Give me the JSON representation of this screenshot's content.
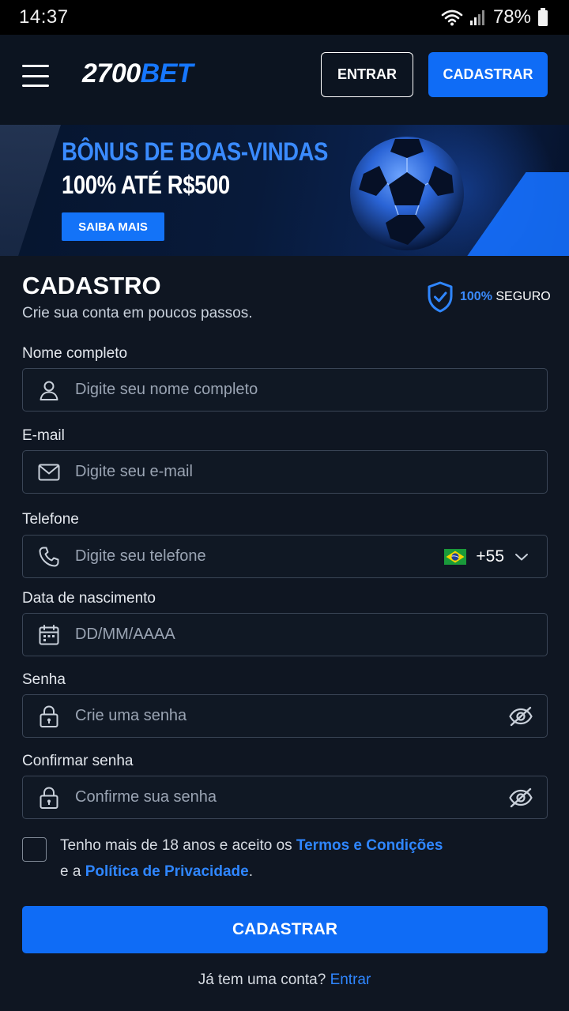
{
  "status_bar": {
    "time": "14:37",
    "battery": "78%",
    "icons": [
      "wifi-icon",
      "signal-icon",
      "battery-icon"
    ]
  },
  "header": {
    "logo_number": "2700",
    "logo_bet": "BET",
    "login_label": "ENTRAR",
    "register_label": "CADASTRAR"
  },
  "banner": {
    "line1": "BÔNUS DE BOAS-VINDAS",
    "line2": "100% ATÉ R$500",
    "cta_label": "SAIBA MAIS"
  },
  "form": {
    "title": "CADASTRO",
    "subtitle": "Crie sua conta em poucos passos.",
    "secure_pct": "100%",
    "secure_text": "SEGURO",
    "fields": {
      "name": {
        "label": "Nome completo",
        "placeholder": "Digite seu nome completo",
        "value": ""
      },
      "email": {
        "label": "E-mail",
        "placeholder": "Digite seu e-mail",
        "value": ""
      },
      "phone": {
        "label": "Telefone",
        "placeholder": "Digite seu telefone",
        "value": "",
        "country_code": "+55"
      },
      "birthdate": {
        "label": "Data de nascimento",
        "placeholder": "DD/MM/AAAA",
        "value": ""
      },
      "password": {
        "label": "Senha",
        "placeholder": "Crie uma senha",
        "value": ""
      },
      "confirm_password": {
        "label": "Confirmar senha",
        "placeholder": "Confirme sua senha",
        "value": ""
      }
    },
    "terms": {
      "checked": false,
      "text_before": "Tenho mais de 18 anos e aceito os ",
      "terms_link": "Termos e Condições",
      "text_middle": "e a ",
      "privacy_link": "Política de Privacidade",
      "text_end": "."
    },
    "submit_label": "CADASTRAR",
    "login_prompt": "Já tem uma conta? ",
    "login_link": "Entrar"
  },
  "colors": {
    "background": "#0f1622",
    "header": "#0c1420",
    "accent": "#0f6cf6",
    "link": "#2f86ff",
    "field_border": "#3a4556"
  }
}
